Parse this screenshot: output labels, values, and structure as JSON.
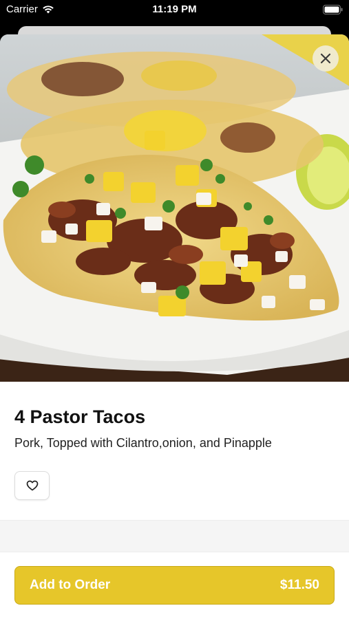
{
  "status_bar": {
    "carrier": "Carrier",
    "time": "11:19 PM"
  },
  "item": {
    "image_alt": "Pastor tacos with pineapple, cilantro and onion",
    "title": "4 Pastor Tacos",
    "description": "Pork, Topped with Cilantro,onion, and Pinapple"
  },
  "order": {
    "button_label": "Add to Order",
    "price": "$11.50"
  },
  "colors": {
    "accent": "#e6c62a",
    "close_button_bg": "#f0ebd7"
  },
  "icons": {
    "close": "close-icon",
    "favorite": "heart-outline-icon",
    "wifi": "wifi-icon",
    "battery": "battery-icon"
  }
}
